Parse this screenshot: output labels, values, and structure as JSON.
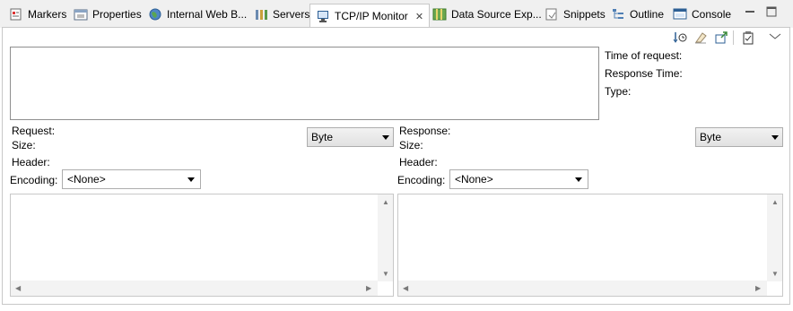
{
  "tabs": [
    {
      "label": "Markers",
      "icon": "markers-icon"
    },
    {
      "label": "Properties",
      "icon": "properties-icon"
    },
    {
      "label": "Internal Web B...",
      "icon": "globe-icon"
    },
    {
      "label": "Servers",
      "icon": "servers-icon"
    },
    {
      "label": "TCP/IP Monitor",
      "icon": "monitor-icon",
      "active": true
    },
    {
      "label": "Data Source Exp...",
      "icon": "data-source-icon"
    },
    {
      "label": "Snippets",
      "icon": "snippets-icon"
    },
    {
      "label": "Outline",
      "icon": "outline-icon"
    },
    {
      "label": "Console",
      "icon": "console-icon"
    }
  ],
  "toolbar_icons": [
    "history-icon",
    "clear-icon",
    "export-icon",
    "properties-icon",
    "view-menu-icon"
  ],
  "info": {
    "time_of_request": "Time of request:",
    "response_time": "Response Time:",
    "type": "Type:"
  },
  "request": {
    "request_label": "Request:",
    "size_label": "Size:",
    "header_label": "Header:",
    "encoding_label": "Encoding:",
    "encoding_value": "<None>",
    "format_value": "Byte"
  },
  "response": {
    "response_label": "Response:",
    "size_label": "Size:",
    "header_label": "Header:",
    "encoding_label": "Encoding:",
    "encoding_value": "<None>",
    "format_value": "Byte"
  },
  "colors": {
    "tab_bar": "#f0f0f0",
    "border": "#8f8f8f",
    "scroll": "#f3f3f3"
  }
}
